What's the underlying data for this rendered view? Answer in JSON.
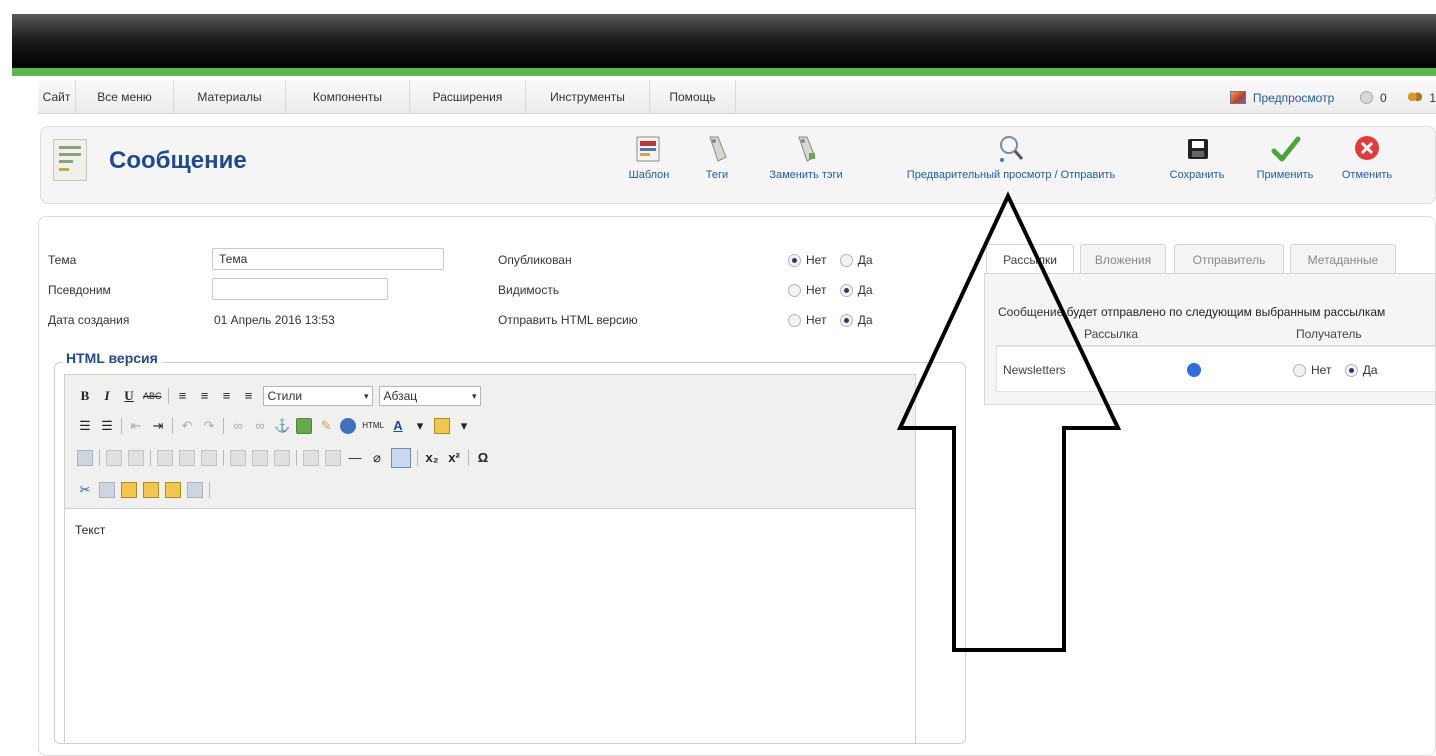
{
  "menu": {
    "items": [
      "Сайт",
      "Все меню",
      "Материалы",
      "Компоненты",
      "Расширения",
      "Инструменты",
      "Помощь"
    ],
    "preview_link": "Предпросмотр",
    "messages_count": "0",
    "users_count": "1"
  },
  "toolbar": {
    "page_title": "Сообщение",
    "buttons": {
      "template": "Шаблон",
      "tags": "Теги",
      "replace_tags": "Заменить тэги",
      "preview_send": "Предварительный просмотр / Отправить",
      "save": "Сохранить",
      "apply": "Применить",
      "cancel": "Отменить"
    }
  },
  "form": {
    "subject_label": "Тема",
    "subject_value": "Тема",
    "alias_label": "Псевдоним",
    "alias_value": "",
    "created_label": "Дата создания",
    "created_value": "01 Апрель 2016 13:53",
    "published_label": "Опубликован",
    "visibility_label": "Видимость",
    "send_html_label": "Отправить HTML версию",
    "no": "Нет",
    "yes": "Да"
  },
  "editor": {
    "legend": "HTML версия",
    "styles_select": "Стили",
    "format_select": "Абзац",
    "content": "Текст"
  },
  "tabs": {
    "items": [
      "Рассылки",
      "Вложения",
      "Отправитель",
      "Метаданные"
    ],
    "description": "Сообщение будет отправлено по следующим выбранным рассылкам",
    "col_list": "Рассылка",
    "col_recipient": "Получатель",
    "row_name": "Newsletters",
    "row_no": "Нет",
    "row_yes": "Да"
  }
}
